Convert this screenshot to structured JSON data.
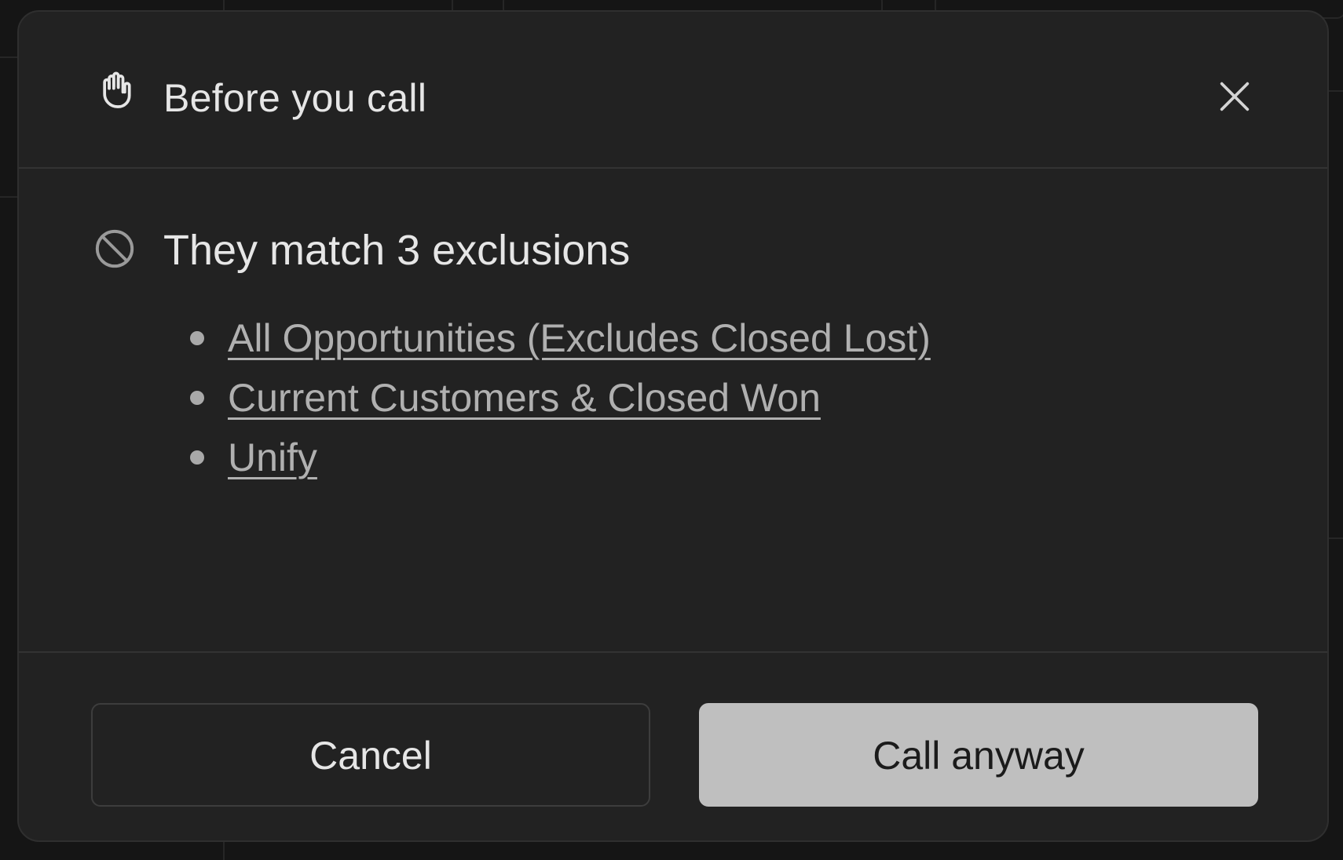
{
  "dialog": {
    "title": "Before you call",
    "header_icon": "hand-icon",
    "close_icon": "close-icon"
  },
  "exclusions": {
    "heading": "They match 3 exclusions",
    "icon": "ban-icon",
    "items": [
      {
        "label": "All Opportunities (Excludes Closed Lost)"
      },
      {
        "label": "Current Customers & Closed Won"
      },
      {
        "label": "Unify"
      }
    ]
  },
  "actions": {
    "cancel_label": "Cancel",
    "call_label": "Call anyway"
  },
  "colors": {
    "dialog_background": "#222222",
    "primary_button": "#bfbfbf",
    "link_text": "#b0b0b0"
  }
}
